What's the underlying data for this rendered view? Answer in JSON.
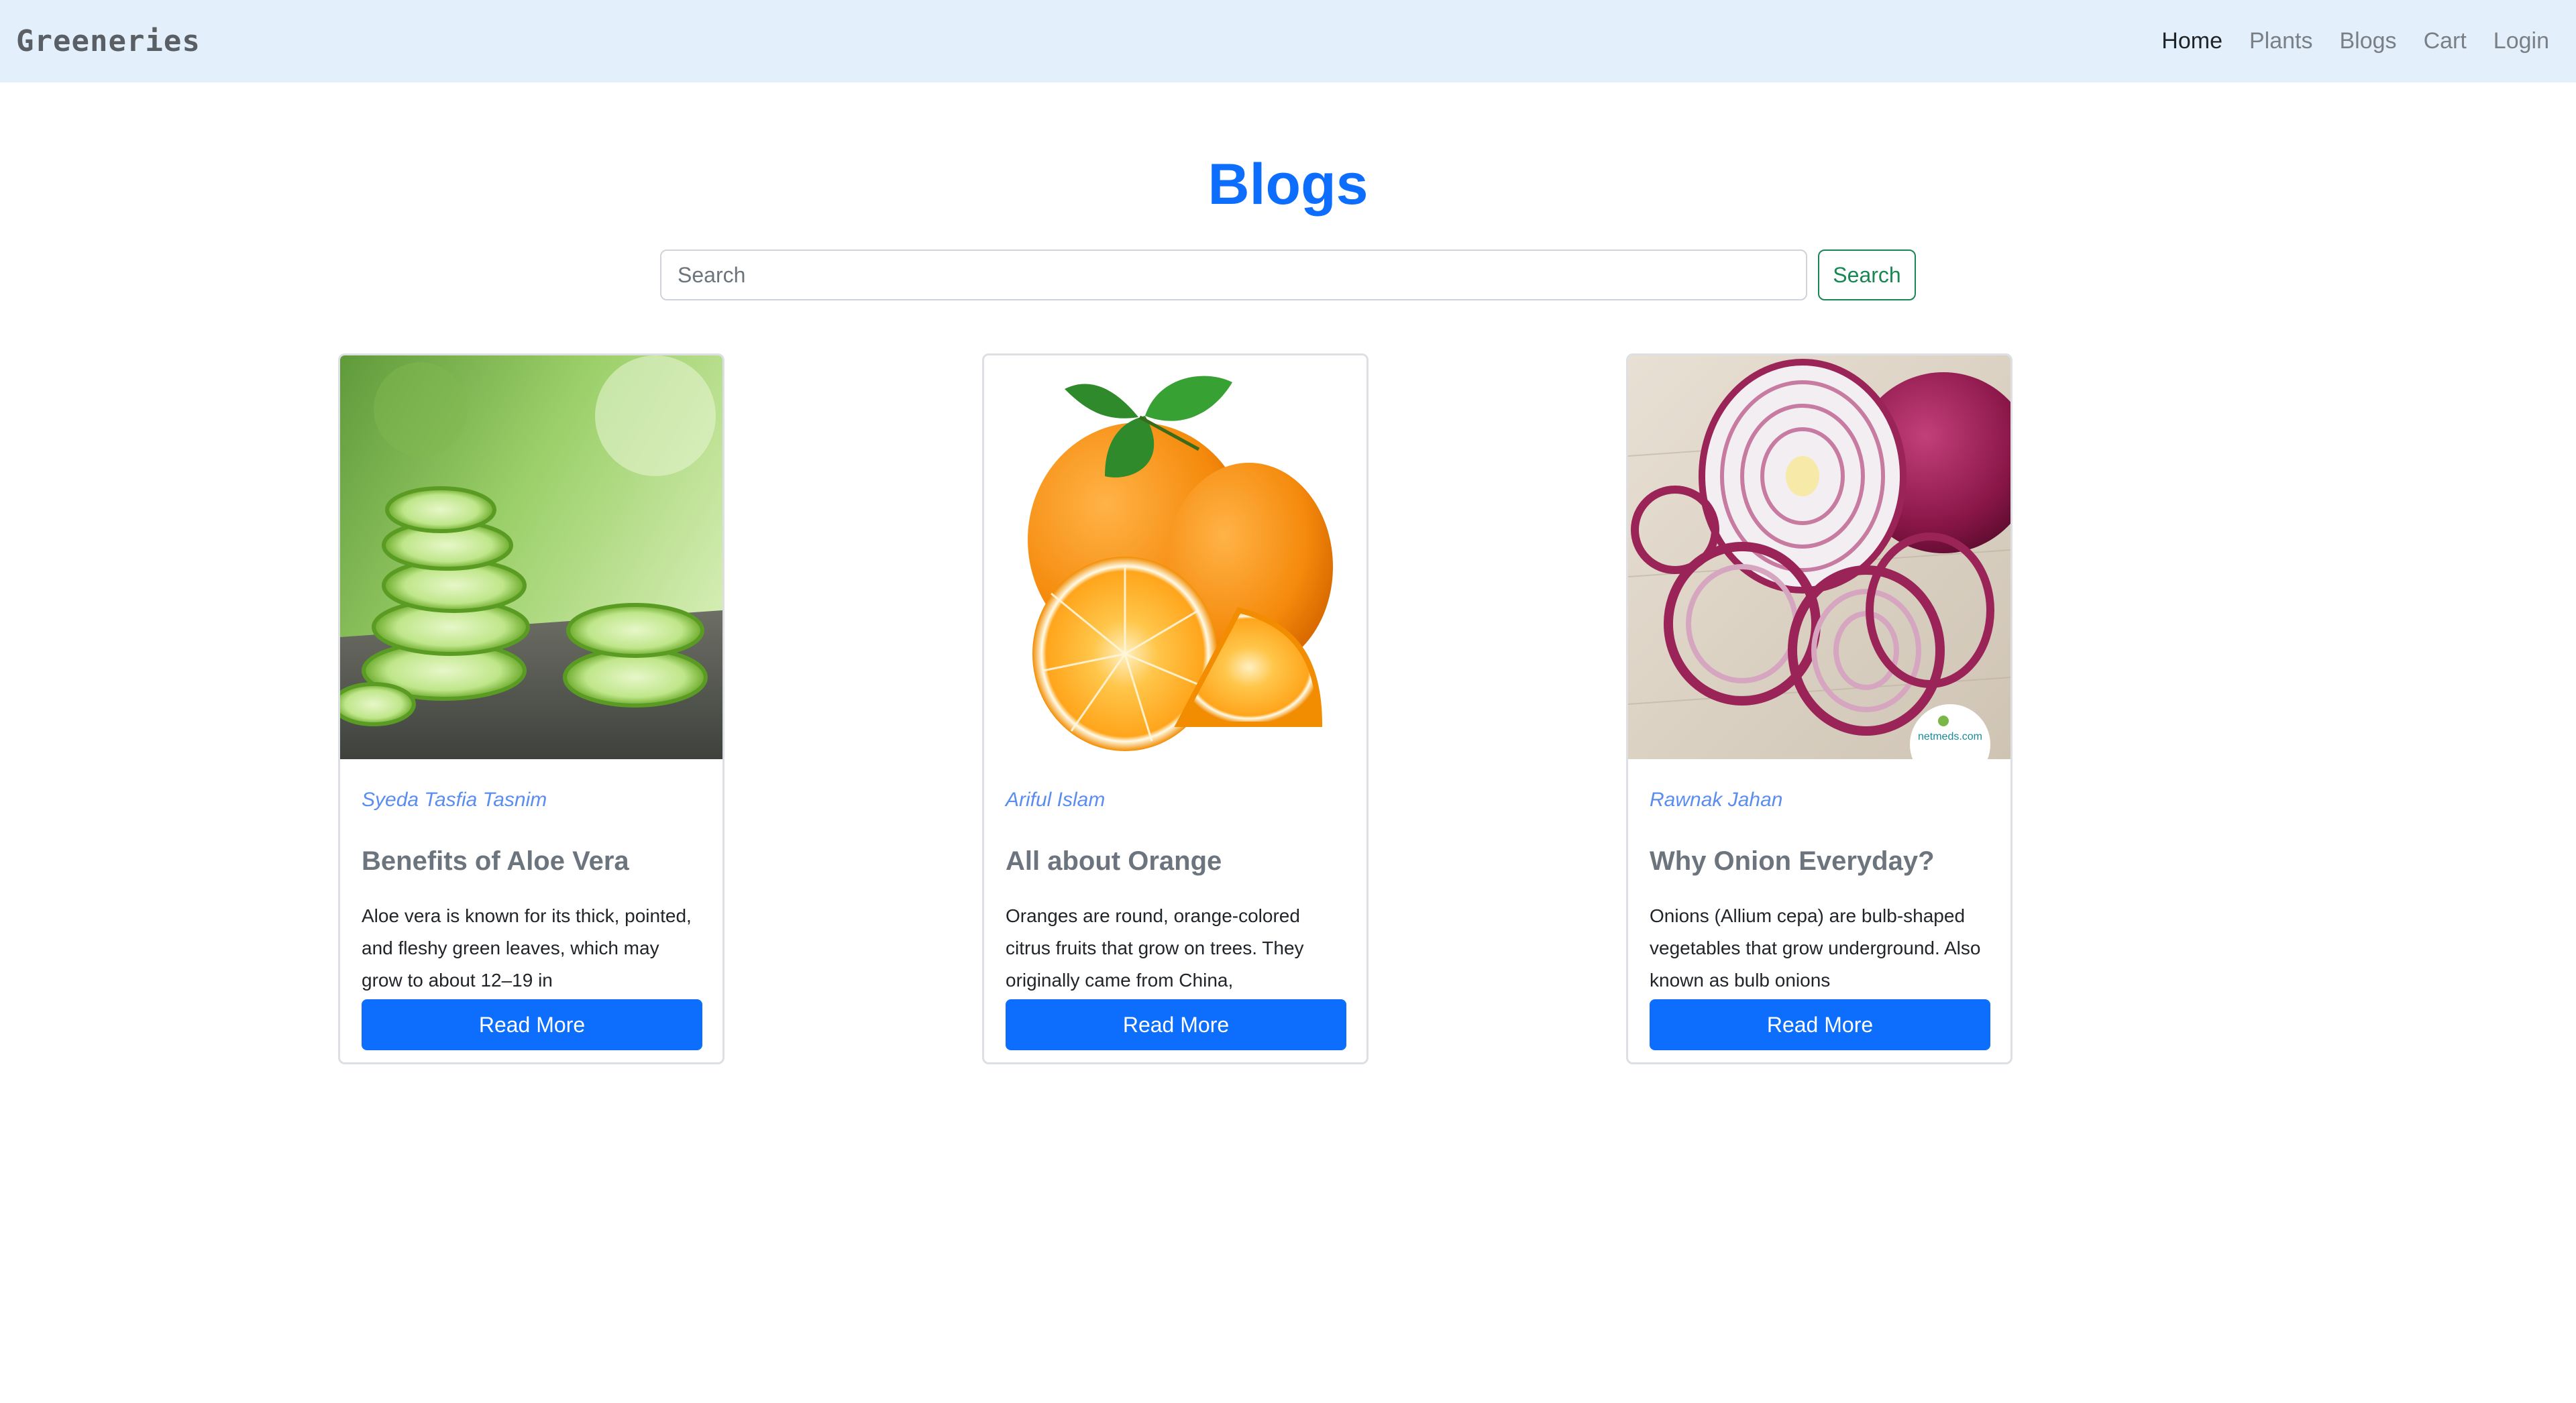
{
  "navbar": {
    "brand": "Greeneries",
    "links": [
      "Home",
      "Plants",
      "Blogs",
      "Cart",
      "Login"
    ]
  },
  "page": {
    "title": "Blogs"
  },
  "search": {
    "placeholder": "Search",
    "value": "",
    "button_label": "Search"
  },
  "blogs": [
    {
      "author": "Syeda Tasfia Tasnim",
      "title": "Benefits of Aloe Vera",
      "excerpt": "Aloe vera is known for its thick, pointed, and fleshy green leaves, which may grow to about 12–19 in",
      "button_label": "Read More",
      "image": "aloe-vera-image"
    },
    {
      "author": "Ariful Islam",
      "title": "All about Orange",
      "excerpt": "Oranges are round, orange-colored citrus fruits that grow on trees. They originally came from China,",
      "button_label": "Read More",
      "image": "orange-image"
    },
    {
      "author": "Rawnak Jahan",
      "title": "Why Onion Everyday?",
      "excerpt": "Onions (Allium cepa) are bulb-shaped vegetables that grow underground. Also known as bulb onions",
      "button_label": "Read More",
      "image": "onion-image",
      "image_watermark": "netmeds.com"
    }
  ],
  "colors": {
    "navbar_bg": "#e3f0fb",
    "accent": "#0d6efd",
    "search_button": "#198754"
  }
}
